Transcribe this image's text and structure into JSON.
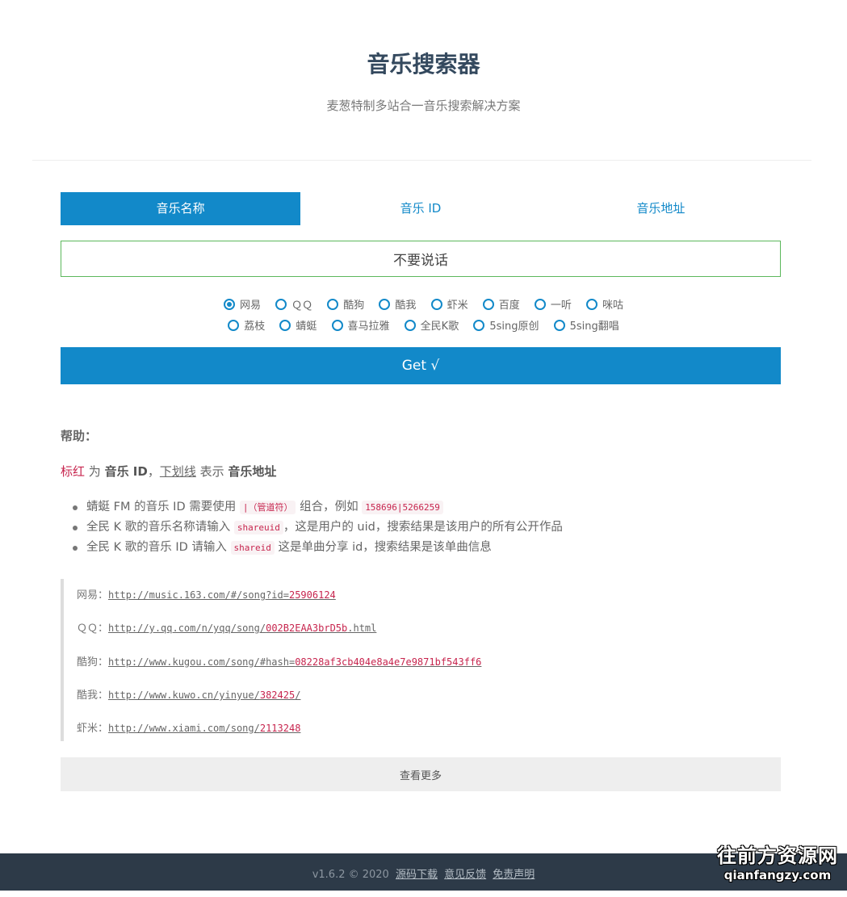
{
  "header": {
    "title": "音乐搜索器",
    "subtitle": "麦葱特制多站合一音乐搜索解决方案"
  },
  "tabs": [
    {
      "label": "音乐名称",
      "active": true
    },
    {
      "label": "音乐 ID",
      "active": false
    },
    {
      "label": "音乐地址",
      "active": false
    }
  ],
  "search": {
    "value": "不要说话"
  },
  "sources_row1": [
    {
      "label": "网易",
      "checked": true
    },
    {
      "label": "ＱＱ",
      "checked": false
    },
    {
      "label": "酷狗",
      "checked": false
    },
    {
      "label": "酷我",
      "checked": false
    },
    {
      "label": "虾米",
      "checked": false
    },
    {
      "label": "百度",
      "checked": false
    },
    {
      "label": "一听",
      "checked": false
    },
    {
      "label": "咪咕",
      "checked": false
    }
  ],
  "sources_row2": [
    {
      "label": "荔枝",
      "checked": false
    },
    {
      "label": "蜻蜓",
      "checked": false
    },
    {
      "label": "喜马拉雅",
      "checked": false
    },
    {
      "label": "全民K歌",
      "checked": false
    },
    {
      "label": "5sing原创",
      "checked": false
    },
    {
      "label": "5sing翻唱",
      "checked": false
    }
  ],
  "get_button": "Get √",
  "help": {
    "title": "帮助：",
    "legend": {
      "red_word": "标红",
      "is1": " 为 ",
      "music_id": "音乐 ID",
      "comma": "，",
      "underline_word": "下划线",
      "is2": " 表示 ",
      "music_url": "音乐地址"
    },
    "tips": [
      {
        "pre": "蜻蜓 FM 的音乐 ID 需要使用 ",
        "code": "|（管道符）",
        "post": " 组合，例如 ",
        "code2": "158696|5266259"
      },
      {
        "pre": "全民 K 歌的音乐名称请输入 ",
        "code": "shareuid",
        "post": "，这是用户的 uid，搜索结果是该用户的所有公开作品"
      },
      {
        "pre": "全民 K 歌的音乐 ID 请输入 ",
        "code": "shareid",
        "post": " 这是单曲分享 id，搜索结果是该单曲信息"
      }
    ]
  },
  "examples": [
    {
      "label": "网易：",
      "base": "http://music.163.com/#/song?id=",
      "id": "25906124",
      "tail": ""
    },
    {
      "label": "ＱＱ：",
      "base": "http://y.qq.com/n/yqq/song/",
      "id": "002B2EAA3brD5b",
      "tail": ".html"
    },
    {
      "label": "酷狗：",
      "base": "http://www.kugou.com/song/#hash=",
      "id": "08228af3cb404e8a4e7e9871bf543ff6",
      "tail": ""
    },
    {
      "label": "酷我：",
      "base": "http://www.kuwo.cn/yinyue/",
      "id": "382425",
      "tail": "/"
    },
    {
      "label": "虾米：",
      "base": "http://www.xiami.com/song/",
      "id": "2113248",
      "tail": ""
    }
  ],
  "more_button": "查看更多",
  "footer": {
    "version": "v1.6.2 © 2020",
    "links": [
      "源码下载",
      "意见反馈",
      "免责声明"
    ]
  },
  "watermark": {
    "line1": "往前方资源网",
    "line2": "qianfangzy.com"
  },
  "colors": {
    "accent": "#1289c9",
    "input_border": "#5cb85c",
    "code_red": "#c7254e",
    "footer_bg": "#2d3a48"
  }
}
